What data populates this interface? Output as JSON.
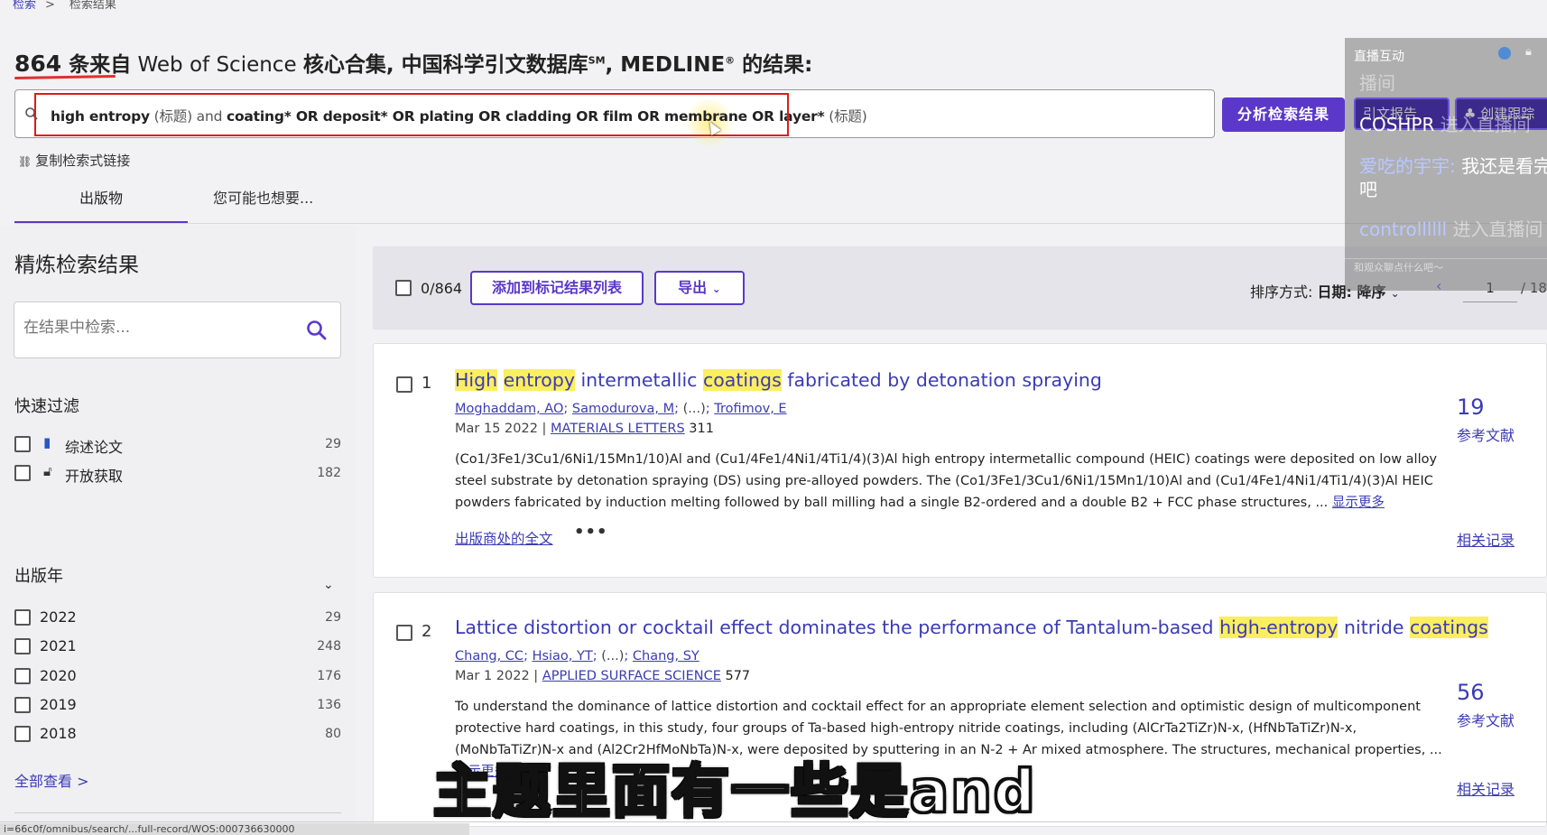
{
  "breadcrumb": {
    "link": "检索",
    "sep": ">",
    "current": "检索结果"
  },
  "heading": {
    "count": "864",
    "text_bold_1": " 条来自",
    "text_2": " Web of Science ",
    "text_bold_3": "核心合集, 中国科学引文数据库",
    "sm": "SM",
    "text_4": ", MEDLINE",
    "reg": "®",
    "text_bold_5": " 的结果:"
  },
  "query": {
    "p1": "high entropy",
    "p2": " (标题) and ",
    "p3": "coating* OR deposit* OR plating OR cladding OR film OR membrane OR layer*",
    "p4": " (标题)"
  },
  "analyze_button": "分析检索结果",
  "copy_link": "复制检索式链接",
  "tabs": {
    "pubs": "出版物",
    "maybe": "您可能也想要..."
  },
  "refine": {
    "title": "精炼检索结果",
    "placeholder": "在结果中检索...",
    "quick_filter": "快速过滤",
    "quick": [
      {
        "label": "综述论文",
        "icon": "document-icon",
        "count": "29"
      },
      {
        "label": "开放获取",
        "icon": "lock-icon",
        "count": "182"
      }
    ],
    "year_title": "出版年",
    "years": [
      {
        "label": "2022",
        "count": "29"
      },
      {
        "label": "2021",
        "count": "248"
      },
      {
        "label": "2020",
        "count": "176"
      },
      {
        "label": "2019",
        "count": "136"
      },
      {
        "label": "2018",
        "count": "80"
      }
    ],
    "view_all": "全部查看 >"
  },
  "toolbar": {
    "selected": "0/864",
    "add_marked": "添加到标记结果列表",
    "export": "导出",
    "sort_label": "排序方式: ",
    "sort_value": "日期: 降序",
    "page_current": "1",
    "page_total": "/ 18"
  },
  "results": [
    {
      "num": "1",
      "title_parts": [
        "High",
        " ",
        "entropy",
        " intermetallic ",
        "coatings",
        " fabricated by detonation spraying"
      ],
      "authors": [
        "Moghaddam, AO",
        "Samodurova, M",
        "(...)",
        "Trofimov, E"
      ],
      "date": "Mar 15 2022 | ",
      "journal": "MATERIALS LETTERS",
      "volume": " 311",
      "abstract": "(Co1/3Fe1/3Cu1/6Ni1/15Mn1/10)Al and (Cu1/4Fe1/4Ni1/4Ti1/4)(3)Al high entropy intermetallic compound (HEIC) coatings were deposited on low alloy steel substrate by detonation spraying (DS) using pre-alloyed powders. The (Co1/3Fe1/3Cu1/6Ni1/15Mn1/10)Al and (Cu1/4Fe1/4Ni1/4Ti1/4)(3)Al HEIC powders fabricated by induction melting followed by ball milling had a single B2-ordered and a double B2 + FCC phase structures,  ... ",
      "show_more": "显示更多",
      "fulltext": "出版商处的全文",
      "dots": "•••",
      "citations": "19",
      "cite_label": "参考文献",
      "related": "相关记录"
    },
    {
      "num": "2",
      "title_parts": [
        "Lattice distortion or cocktail effect dominates the performance of Tantalum-based ",
        "high",
        "-",
        "entropy",
        " nitride ",
        "coatings"
      ],
      "authors": [
        "Chang, CC",
        "Hsiao, YT",
        "(...)",
        "Chang, SY"
      ],
      "date": "Mar 1 2022 | ",
      "journal": "APPLIED SURFACE SCIENCE",
      "volume": " 577",
      "abstract": "To understand the dominance of lattice distortion and cocktail effect for an appropriate element selection and optimistic design of multicomponent protective hard coatings, in this study, four groups of Ta-based high-entropy nitride coatings, including (AlCrTa2TiZr)N-x, (HfNbTaTiZr)N-x, (MoNbTaTiZr)N-x and (Al2Cr2HfMoNbTa)N-x, were deposited by sputtering in an N-2 + Ar mixed atmosphere. The structures, mechanical properties,  ... ",
      "show_more": "显示更多",
      "citations": "56",
      "cite_label": "参考文献",
      "related": "相关记录"
    }
  ],
  "live_overlay": {
    "title": "直播互动",
    "sub": "播间",
    "btn1": "引文报告",
    "btn2": "♣ 创建跟踪",
    "msg1_user": "COSHPR",
    "msg1_text": " 进入直播间",
    "msg2_user": "爱吃的宇宇: ",
    "msg2_text": "我还是看完",
    "msg2_text2": "吧",
    "msg3_user": "controllllll",
    "msg3_text": " 进入直播间",
    "chat_hint": "和观众聊点什么吧～"
  },
  "subtitle": "主题里面有一些是and",
  "status_url": "i=66c0f/omnibus/search/...full-record/WOS:000736630000"
}
